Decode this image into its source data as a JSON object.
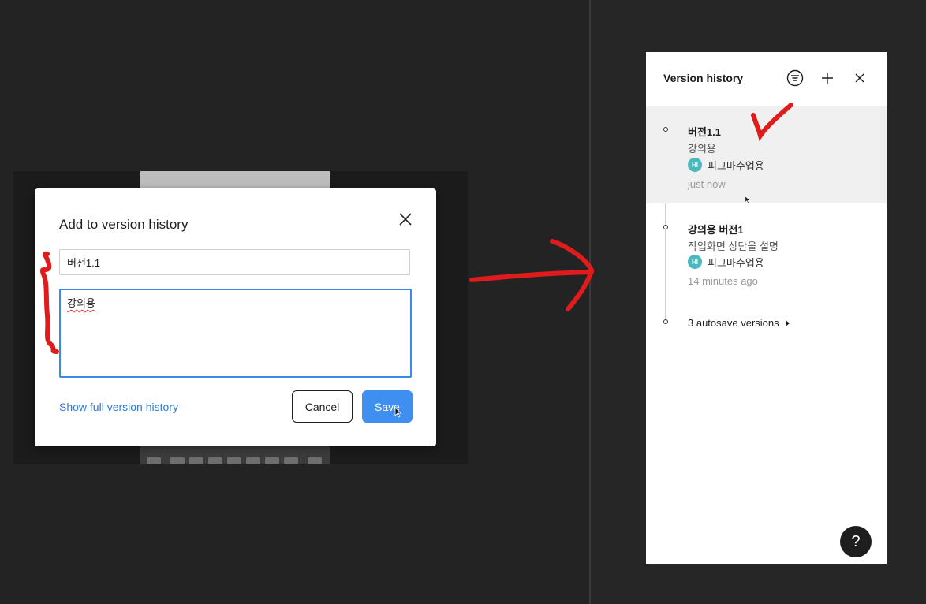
{
  "dialog": {
    "title": "Add to version history",
    "name_value": "버전1.1",
    "description_value": "강의용",
    "show_full_link": "Show full version history",
    "cancel_label": "Cancel",
    "save_label": "Save"
  },
  "panel": {
    "title": "Version history",
    "icons": [
      "filter-icon",
      "plus-icon",
      "close-icon"
    ],
    "versions": [
      {
        "name": "버전1.1",
        "description": "강의용",
        "author_initials": "HI",
        "author": "피그마수업용",
        "time": "just now"
      },
      {
        "name": "강의용 버전1",
        "description": "작업화면 상단을 설명",
        "author_initials": "HI",
        "author": "피그마수업용",
        "time": "14 minutes ago"
      }
    ],
    "autosave_label": "3 autosave versions",
    "help_label": "?"
  },
  "colors": {
    "accent": "#3f8ff0",
    "link": "#2f7ad6",
    "avatar": "#4ab8bd",
    "annotation": "#e01b1b",
    "background": "#232323"
  }
}
